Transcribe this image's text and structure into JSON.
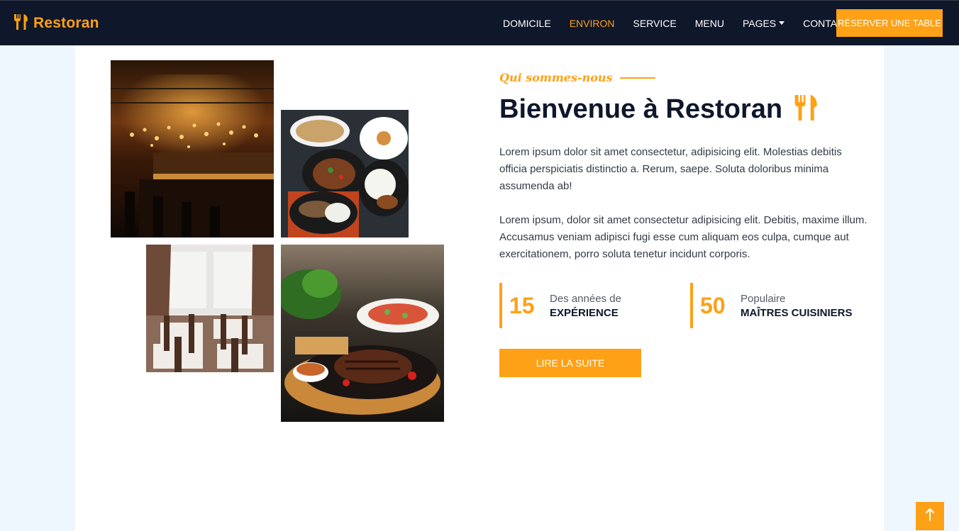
{
  "navbar": {
    "brand": "Restoran",
    "items": [
      {
        "label": "DOMICILE",
        "active": false
      },
      {
        "label": "ENVIRON",
        "active": true
      },
      {
        "label": "SERVICE",
        "active": false
      },
      {
        "label": "MENU",
        "active": false
      },
      {
        "label": "PAGES",
        "active": false,
        "dropdown": true
      },
      {
        "label": "CONTACT",
        "active": false
      }
    ],
    "reserve_label": "RÉSERVER UNE TABLE"
  },
  "about": {
    "subtitle": "Qui sommes-nous",
    "title": "Bienvenue à Restoran",
    "paragraphs": [
      "Lorem ipsum dolor sit amet consectetur, adipisicing elit. Molestias debitis officia perspiciatis distinctio a. Rerum, saepe. Soluta doloribus minima assumenda ab!",
      "Lorem ipsum, dolor sit amet consectetur adipisicing elit. Debitis, maxime illum. Accusamus veniam adipisci fugi esse cum aliquam eos culpa, cumque aut exercitationem, porro soluta tenetur incidunt corporis."
    ],
    "stats": [
      {
        "number": "15",
        "label": "Des années de",
        "strong": "EXPÉRIENCE"
      },
      {
        "number": "50",
        "label": "Populaire",
        "strong": "MAÎTRES CUISINIERS"
      }
    ],
    "read_more": "LIRE LA SUITE"
  },
  "icons": {
    "brand": "utensils-icon",
    "title": "utensils-icon",
    "back_to_top": "arrow-up-icon"
  },
  "colors": {
    "primary": "#fea116",
    "dark": "#0f172b"
  }
}
